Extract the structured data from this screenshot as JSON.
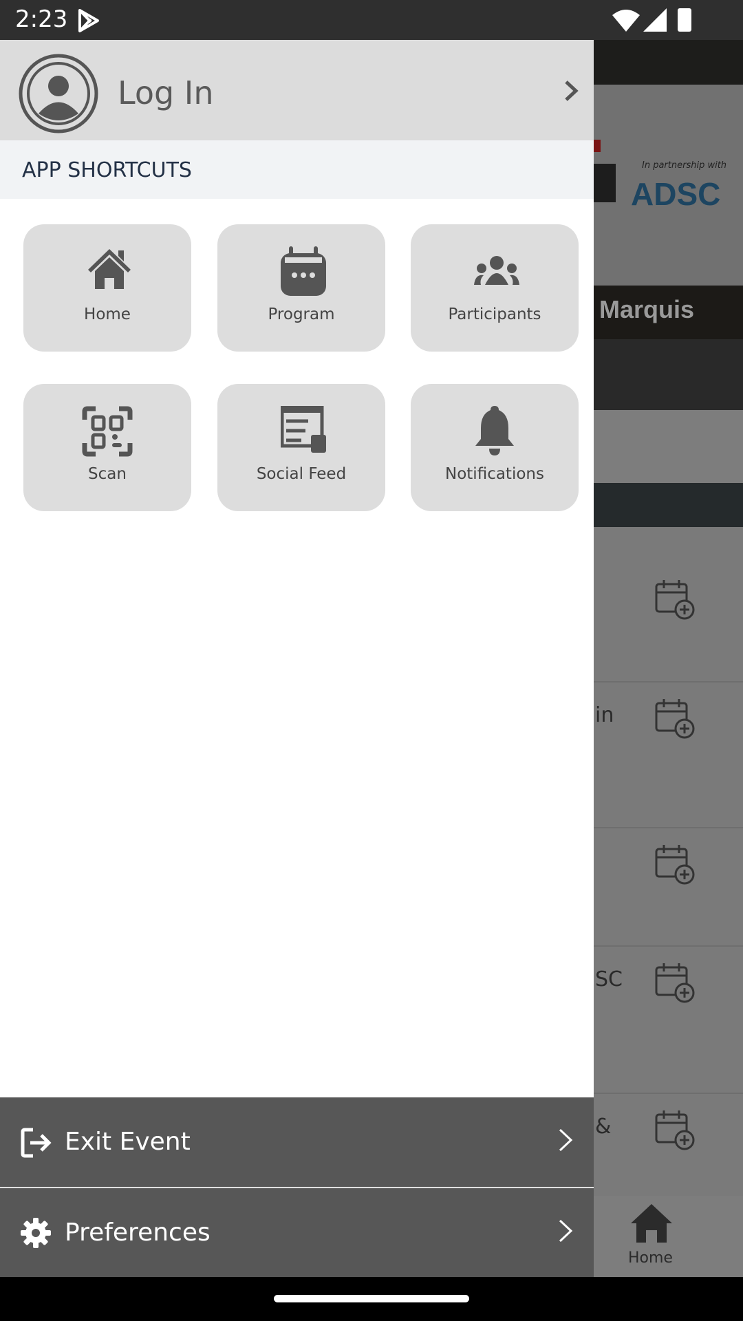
{
  "status_bar": {
    "time": "2:23",
    "icons": [
      "play-store-icon",
      "wifi-icon",
      "signal-icon",
      "battery-icon"
    ]
  },
  "drawer": {
    "login_label": "Log In",
    "shortcuts_header": "APP SHORTCUTS",
    "shortcuts": [
      {
        "label": "Home",
        "icon": "home-icon"
      },
      {
        "label": "Program",
        "icon": "calendar-icon"
      },
      {
        "label": "Participants",
        "icon": "users-icon"
      },
      {
        "label": "Scan",
        "icon": "qr-scan-icon"
      },
      {
        "label": "Social Feed",
        "icon": "social-feed-icon"
      },
      {
        "label": "Notifications",
        "icon": "bell-icon"
      }
    ],
    "exit_label": "Exit Event",
    "preferences_label": "Preferences"
  },
  "background": {
    "banner_partner_text": "In partnership with",
    "banner_logo": "ADSC",
    "banner_title_fragment": "Marquis",
    "row_fragments": [
      "",
      "in",
      "",
      "SC",
      "&"
    ],
    "bottom_nav_home": "Home"
  },
  "colors": {
    "drawer_bottom": "#575757",
    "tile": "#dddddd",
    "header": "#dcdcdc",
    "shortcuts_band": "#f1f3f5"
  }
}
